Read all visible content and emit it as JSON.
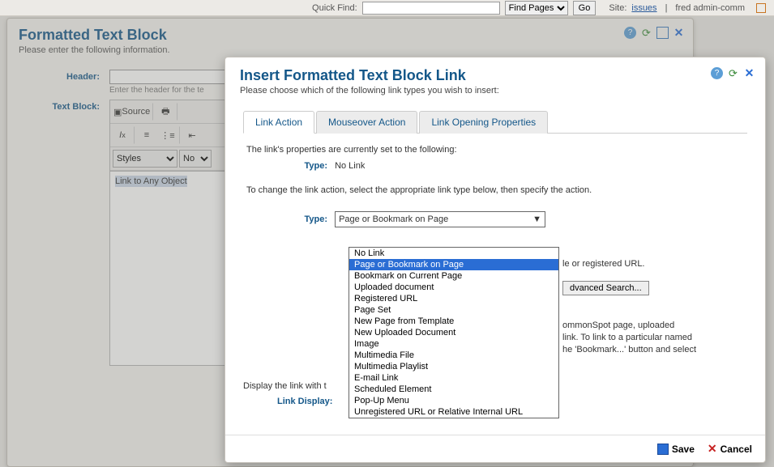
{
  "topbar": {
    "quickfind_label": "Quick Find:",
    "findpages_label": "Find Pages",
    "go_label": "Go",
    "site_label": "Site:",
    "site_link": "issues",
    "user": "fred admin-comm"
  },
  "back_window": {
    "title": "Formatted Text Block",
    "subtitle": "Please enter the following information.",
    "header_label": "Header:",
    "header_hint": "Enter the header for the te",
    "textblock_label": "Text Block:",
    "toolbar": {
      "source": "Source",
      "styles": "Styles",
      "normal": "No"
    },
    "editor_selected": "Link to Any Object"
  },
  "modal": {
    "title": "Insert Formatted Text Block Link",
    "subtitle": "Please choose which of the following link types you wish to insert:",
    "tabs": {
      "action": "Link Action",
      "mouseover": "Mouseover Action",
      "opening": "Link Opening Properties"
    },
    "current_line": "The link's properties are currently set to the following:",
    "type_label": "Type:",
    "current_type": "No Link",
    "change_line": "To change the link action, select the appropriate link type below, then specify the action.",
    "type_selected": "Page or Bookmark on Page",
    "options": [
      "No Link",
      "Page or Bookmark on Page",
      "Bookmark on Current Page",
      "Uploaded document",
      "Registered URL",
      "Page Set",
      "New Page from Template",
      "New Uploaded Document",
      "Image",
      "Multimedia File",
      "Multimedia Playlist",
      "E-mail Link",
      "Scheduled Element",
      "Pop-Up Menu",
      "Unregistered URL or Relative Internal URL"
    ],
    "behind1": "le or registered URL.",
    "adv_search": "dvanced Search...",
    "behind2a": "ommonSpot page, uploaded",
    "behind2b": "link. To link to a particular named",
    "behind2c": "he 'Bookmark...' button and select",
    "display_line": "Display the link with t",
    "linkdisplay_label": "Link Display:",
    "save": "Save",
    "cancel": "Cancel"
  }
}
